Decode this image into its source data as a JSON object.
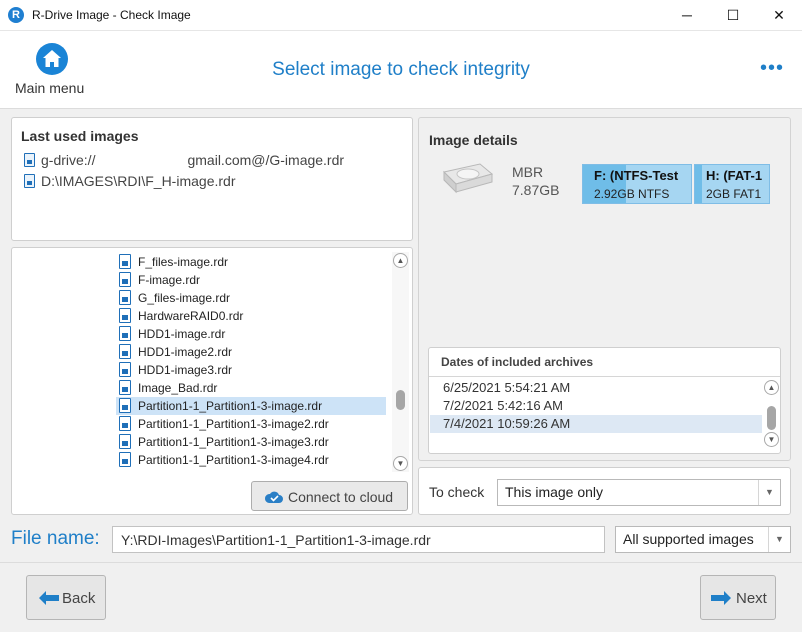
{
  "window": {
    "title": "R-Drive Image - Check Image",
    "app_icon_letter": "R",
    "minimize_glyph": "─",
    "maximize_glyph": "☐",
    "close_glyph": "✕"
  },
  "header": {
    "main_menu_label": "Main menu",
    "page_title": "Select image to check integrity",
    "more_glyph": "•••"
  },
  "last_used": {
    "title": "Last used images",
    "items": [
      {
        "prefix": "g-drive://",
        "suffix": "gmail.com@/G-image.rdr"
      },
      {
        "prefix": "D:\\IMAGES\\RDI\\F_H-image.rdr",
        "suffix": ""
      }
    ]
  },
  "file_browser": {
    "files": [
      "F_files-image.rdr",
      "F-image.rdr",
      "G_files-image.rdr",
      "HardwareRAID0.rdr",
      "HDD1-image.rdr",
      "HDD1-image2.rdr",
      "HDD1-image3.rdr",
      "Image_Bad.rdr",
      "Partition1-1_Partition1-3-image.rdr",
      "Partition1-1_Partition1-3-image2.rdr",
      "Partition1-1_Partition1-3-image3.rdr",
      "Partition1-1_Partition1-3-image4.rdr"
    ],
    "selected_index": 8,
    "connect_cloud_label": "Connect to cloud"
  },
  "image_details": {
    "title": "Image details",
    "disk_type": "MBR",
    "disk_size": "7.87GB",
    "partitions": [
      {
        "name": "F: (NTFS-Test",
        "detail": "2.92GB NTFS",
        "used_fraction": 0.4
      },
      {
        "name": "H: (FAT-1",
        "detail": "2GB FAT1",
        "used_fraction": 0.1
      }
    ],
    "dates_title": "Dates of included archives",
    "dates": [
      "6/25/2021 5:54:21 AM",
      "7/2/2021 5:42:16 AM",
      "7/4/2021 10:59:26 AM"
    ],
    "selected_date_index": 2
  },
  "to_check": {
    "label": "To check",
    "value": "This image only"
  },
  "file_name": {
    "label": "File name:",
    "value": "Y:\\RDI-Images\\Partition1-1_Partition1-3-image.rdr",
    "filter": "All supported images"
  },
  "footer": {
    "back_label": "Back",
    "next_label": "Next"
  },
  "colors": {
    "accent": "#1f7fc8",
    "selection": "#cde3f7",
    "partition_fill": "#6fbde8",
    "partition_bg": "#a6d6f2"
  }
}
